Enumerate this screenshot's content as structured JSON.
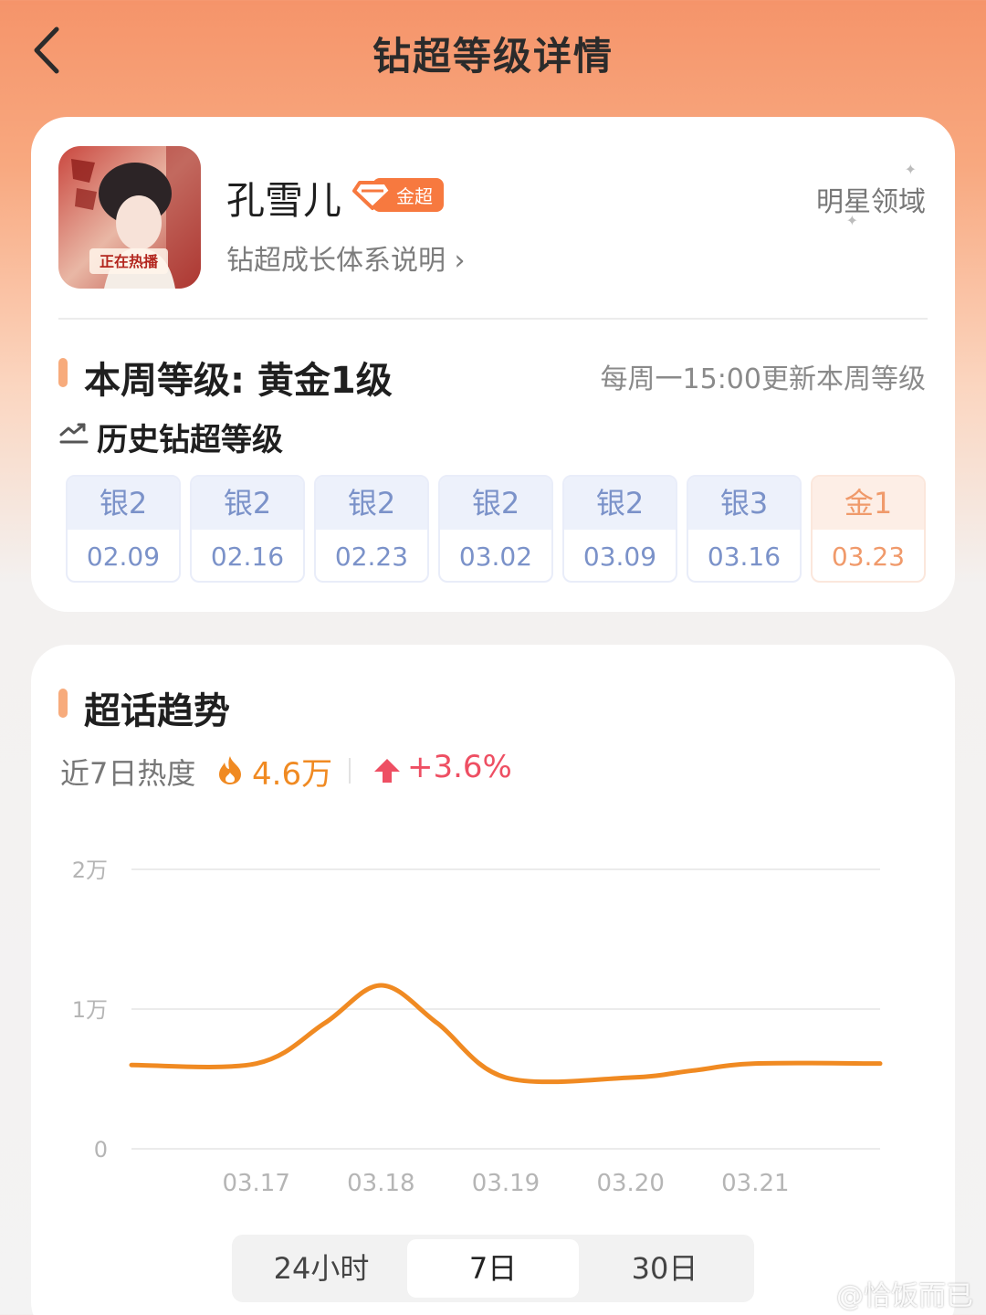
{
  "nav": {
    "title": "钻超等级详情"
  },
  "profile": {
    "name": "孔雪儿",
    "badge": "金超",
    "growth_link": "钻超成长体系说明 ›",
    "domain_link": "明星领域",
    "avatar_text": "正在热播"
  },
  "level": {
    "current": "本周等级: 黄金1级",
    "update_note": "每周一15:00更新本周等级",
    "history_title": "历史钻超等级",
    "history": [
      {
        "level": "银2",
        "date": "02.09"
      },
      {
        "level": "银2",
        "date": "02.16"
      },
      {
        "level": "银2",
        "date": "02.23"
      },
      {
        "level": "银2",
        "date": "03.02"
      },
      {
        "level": "银2",
        "date": "03.09"
      },
      {
        "level": "银3",
        "date": "03.16"
      },
      {
        "level": "金1",
        "date": "03.23"
      }
    ]
  },
  "trend": {
    "title": "超话趋势",
    "heat_label": "近7日热度",
    "heat_value": "4.6万",
    "delta": "+3.6%",
    "tabs": [
      "24小时",
      "7日",
      "30日"
    ],
    "active_tab": "7日"
  },
  "chart_data": {
    "type": "line",
    "x": [
      "03.17",
      "03.18",
      "03.19",
      "03.20",
      "03.21"
    ],
    "y_ticks": [
      "0",
      "1万",
      "2万"
    ],
    "ylim": [
      0,
      20000
    ],
    "series": [
      {
        "color": "#f08a22",
        "points": [
          {
            "x": 16.0,
            "y": 6000
          },
          {
            "x": 17.0,
            "y": 6100
          },
          {
            "x": 17.55,
            "y": 9000
          },
          {
            "x": 18.0,
            "y": 11700
          },
          {
            "x": 18.45,
            "y": 9000
          },
          {
            "x": 19.0,
            "y": 5100
          },
          {
            "x": 20.0,
            "y": 5100
          },
          {
            "x": 20.5,
            "y": 5600
          },
          {
            "x": 21.0,
            "y": 6100
          },
          {
            "x": 22.0,
            "y": 6100
          }
        ]
      }
    ],
    "grid": true
  },
  "watermark": "@恰饭而已",
  "colors": {
    "accent": "#f08a22",
    "up": "#ee4f63",
    "silver": "#7b92c9",
    "gold": "#f09a6b"
  }
}
